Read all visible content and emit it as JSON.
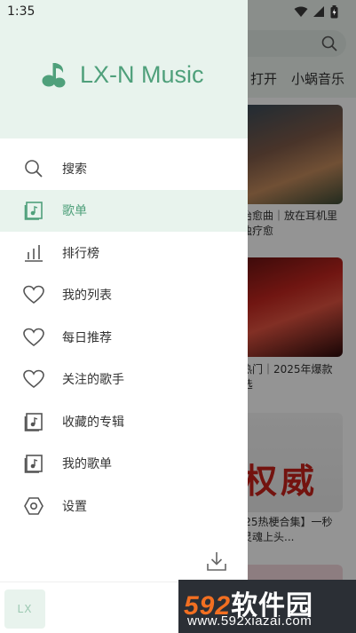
{
  "status": {
    "time": "1:35"
  },
  "brand": {
    "name": "LX-N Music"
  },
  "menu": {
    "items": [
      {
        "label": "搜索",
        "icon": "search-icon",
        "active": false
      },
      {
        "label": "歌单",
        "icon": "playlist-icon",
        "active": true
      },
      {
        "label": "排行榜",
        "icon": "chart-icon",
        "active": false
      },
      {
        "label": "我的列表",
        "icon": "heart-icon",
        "active": false
      },
      {
        "label": "每日推荐",
        "icon": "heart-icon",
        "active": false
      },
      {
        "label": "关注的歌手",
        "icon": "heart-icon",
        "active": false
      },
      {
        "label": "收藏的专辑",
        "icon": "album-icon",
        "active": false
      },
      {
        "label": "我的歌单",
        "icon": "album-icon",
        "active": false
      },
      {
        "label": "设置",
        "icon": "settings-icon",
        "active": false
      }
    ]
  },
  "player": {
    "cover_text": "LX"
  },
  "background": {
    "tabs": [
      "打开",
      "小蜗音乐"
    ],
    "cards": [
      {
        "caption": "抖音治愈曲｜放在耳机里的孤独疗愈"
      },
      {
        "caption": "抖音热门｜2025年爆款DJ精选"
      },
      {
        "caption": "【2025热梗合集】一秒沦陷灵魂上头...",
        "art_text": "权威"
      }
    ]
  },
  "watermark": {
    "main_num": "592",
    "main_text": "软件园",
    "url": "www.592xiazai.com"
  },
  "colors": {
    "accent": "#4fa07b",
    "header_bg": "#e8f3ed"
  }
}
